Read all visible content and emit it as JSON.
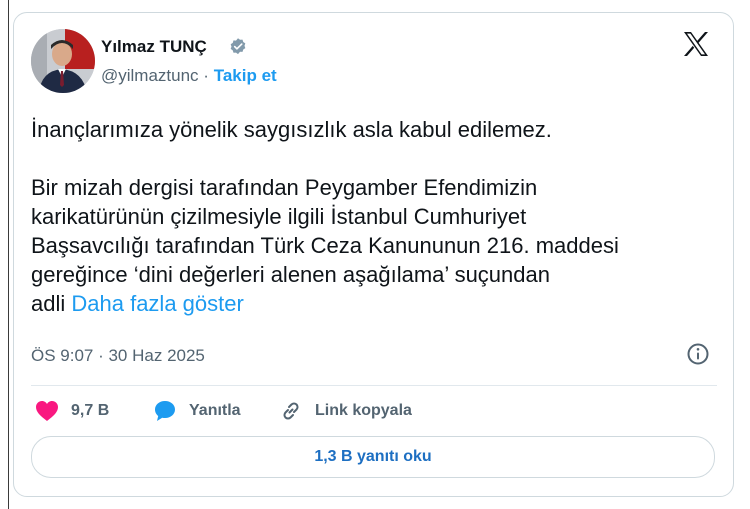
{
  "author": {
    "name": "Yılmaz TUNÇ",
    "handle": "@yilmaztunc",
    "separator": "·",
    "follow_label": "Takip et"
  },
  "tweet": {
    "line1": "İnançlarımıza yönelik saygısızlık asla kabul edilemez.",
    "line2": "Bir mizah dergisi tarafından Peygamber Efendimizin",
    "line3": "karikatürünün çizilmesiyle ilgili İstanbul Cumhuriyet",
    "line4": "Başsavcılığı tarafından Türk Ceza Kanununun 216. maddesi",
    "line5": "gereğince ‘dini değerleri alenen aşağılama’ suçundan",
    "line6_prefix": "adli",
    "show_more": "Daha fazla göster"
  },
  "timestamp": "ÖS 9:07 · 30 Haz 2025",
  "actions": {
    "like_count": "9,7 B",
    "reply_label": "Yanıtla",
    "copy_link_label": "Link kopyala"
  },
  "read_replies_label": "1,3 B yanıtı oku",
  "icons": {
    "like": "heart-icon",
    "reply": "speech-bubble-icon",
    "copy_link": "link-icon",
    "info": "info-icon",
    "platform": "x-logo-icon",
    "verified": "verified-badge-icon"
  },
  "colors": {
    "accent": "#1d9bf0",
    "like": "#f91880",
    "text": "#0f1419",
    "muted": "#536471"
  }
}
